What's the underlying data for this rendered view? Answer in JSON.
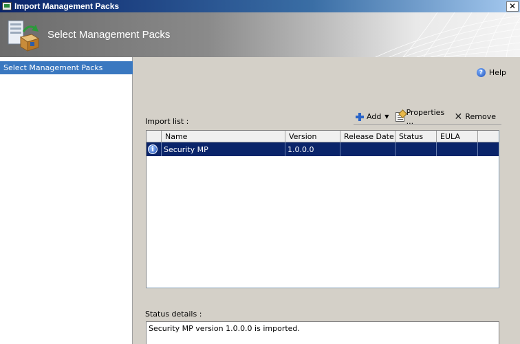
{
  "window": {
    "title": "Import Management Packs",
    "close_glyph": "✕"
  },
  "banner": {
    "title": "Select Management Packs"
  },
  "nav": {
    "items": [
      {
        "label": "Select Management Packs",
        "selected": true
      }
    ]
  },
  "help": {
    "label": "Help",
    "glyph": "?"
  },
  "import_list": {
    "label": "Import list :",
    "toolbar": {
      "add": "Add",
      "properties": "Properties ...",
      "remove": "Remove"
    },
    "columns": [
      "Name",
      "Version",
      "Release Date",
      "Status",
      "EULA"
    ],
    "rows": [
      {
        "icon": "info-icon",
        "name": "Security MP",
        "version": "1.0.0.0",
        "release_date": "",
        "status": "",
        "eula": ""
      }
    ]
  },
  "status_details": {
    "label": "Status details :",
    "text": "Security MP version 1.0.0.0 is imported."
  },
  "colors": {
    "titlebar": "#0a246a",
    "selection": "#0a246a",
    "nav_selected": "#3a78c0",
    "dialog_bg": "#d4d0c8"
  }
}
